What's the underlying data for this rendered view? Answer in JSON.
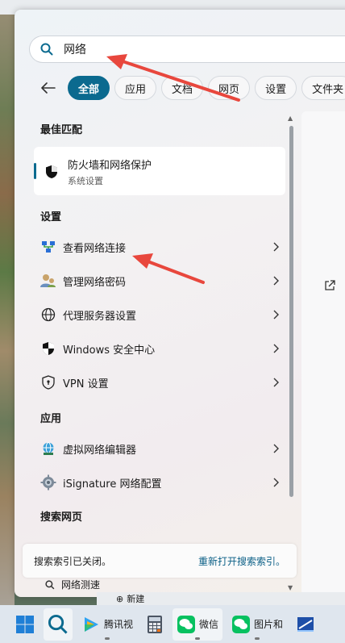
{
  "search": {
    "query": "网络"
  },
  "tabs": [
    "全部",
    "应用",
    "文档",
    "网页",
    "设置",
    "文件夹"
  ],
  "sections": {
    "best_match": "最佳匹配",
    "settings": "设置",
    "apps": "应用",
    "web": "搜索网页"
  },
  "best_match": {
    "title": "防火墙和网络保护",
    "subtitle": "系统设置",
    "icon": "shield-icon"
  },
  "settings_items": [
    {
      "label": "查看网络连接",
      "icon": "network-connections-icon"
    },
    {
      "label": "管理网络密码",
      "icon": "users-key-icon"
    },
    {
      "label": "代理服务器设置",
      "icon": "globe-icon"
    },
    {
      "label": "Windows 安全中心",
      "icon": "shield-icon"
    },
    {
      "label": "VPN 设置",
      "icon": "vpn-shield-icon"
    }
  ],
  "app_items": [
    {
      "label": "虚拟网络编辑器",
      "icon": "globe-network-icon"
    },
    {
      "label": "iSignature 网络配置",
      "icon": "gear-icon"
    }
  ],
  "notice": {
    "text": "搜索索引已关闭。",
    "link": "重新打开搜索索引。"
  },
  "peek_item": "网络测速",
  "desktop": {
    "new_label": "新建"
  },
  "taskbar": [
    {
      "label": "",
      "icon": "windows-start-icon"
    },
    {
      "label": "",
      "icon": "search-icon"
    },
    {
      "label": "腾讯视",
      "icon": "tencent-video-icon"
    },
    {
      "label": "",
      "icon": "calculator-icon"
    },
    {
      "label": "微信",
      "icon": "wechat-icon"
    },
    {
      "label": "图片和",
      "icon": "wechat-icon"
    },
    {
      "label": "",
      "icon": "app-icon"
    }
  ],
  "colors": {
    "accent": "#0b6a8f",
    "arrow": "#e8473d"
  }
}
